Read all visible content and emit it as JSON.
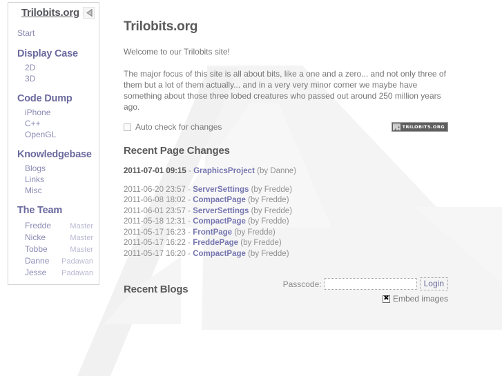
{
  "sidebar": {
    "title": "Trilobits.org",
    "logo_icon": "trilobite-icon",
    "start_label": "Start",
    "sections": [
      {
        "heading": "Display Case",
        "items": [
          "2D",
          "3D"
        ]
      },
      {
        "heading": "Code Dump",
        "items": [
          "iPhone",
          "C++",
          "OpenGL"
        ]
      },
      {
        "heading": "Knowledgebase",
        "items": [
          "Blogs",
          "Links",
          "Misc"
        ]
      }
    ],
    "team_heading": "The Team",
    "team": [
      {
        "name": "Fredde",
        "role": "Master"
      },
      {
        "name": "Nicke",
        "role": "Master"
      },
      {
        "name": "Tobbe",
        "role": "Master"
      },
      {
        "name": "Danne",
        "role": "Padawan"
      },
      {
        "name": "Jesse",
        "role": "Padawan"
      }
    ]
  },
  "main": {
    "title": "Trilobits.org",
    "welcome": "Welcome to our Trilobits site!",
    "intro": "The major focus of this site is all about bits, like a one and a zero... and not only three of them but a lot of them actually... and in a very very minor corner we maybe have something about those three lobed creatures who passed out around 250 million years ago.",
    "autocheck": {
      "label": "Auto check for changes",
      "checked": false
    },
    "badge": {
      "text": "TRILOBITS.ORG",
      "icon": "image-thumbnail-icon"
    },
    "recent_changes": {
      "heading": "Recent Page Changes",
      "entries": [
        {
          "date": "2011-07-01 09:15",
          "page": "GraphicsProject",
          "author": "(by Danne)"
        },
        {
          "date": "2011-06-20 23:57",
          "page": "ServerSettings",
          "author": "(by Fredde)"
        },
        {
          "date": "2011-06-08 18:02",
          "page": "CompactPage",
          "author": "(by Fredde)"
        },
        {
          "date": "2011-06-01 23:57",
          "page": "ServerSettings",
          "author": "(by Fredde)"
        },
        {
          "date": "2011-05-18 12:31",
          "page": "CompactPage",
          "author": "(by Fredde)"
        },
        {
          "date": "2011-05-17 16:23",
          "page": "FrontPage",
          "author": "(by Fredde)"
        },
        {
          "date": "2011-05-17 16:22",
          "page": "FreddePage",
          "author": "(by Fredde)"
        },
        {
          "date": "2011-05-17 16:20",
          "page": "CompactPage",
          "author": "(by Fredde)"
        }
      ],
      "separator": "-"
    },
    "recent_blogs_heading": "Recent Blogs",
    "login": {
      "passcode_label": "Passcode:",
      "passcode_value": "",
      "passcode_placeholder": "",
      "button_label": "Login"
    },
    "embed_images": {
      "label": "Embed images",
      "checked": true
    }
  },
  "colors": {
    "link": "#8a8ab4",
    "heading": "#6a6a9e",
    "page_link": "#7575b0",
    "text": "#757575",
    "watermark": "#f3f3f3",
    "badge_bg": "#5f5f5f"
  }
}
